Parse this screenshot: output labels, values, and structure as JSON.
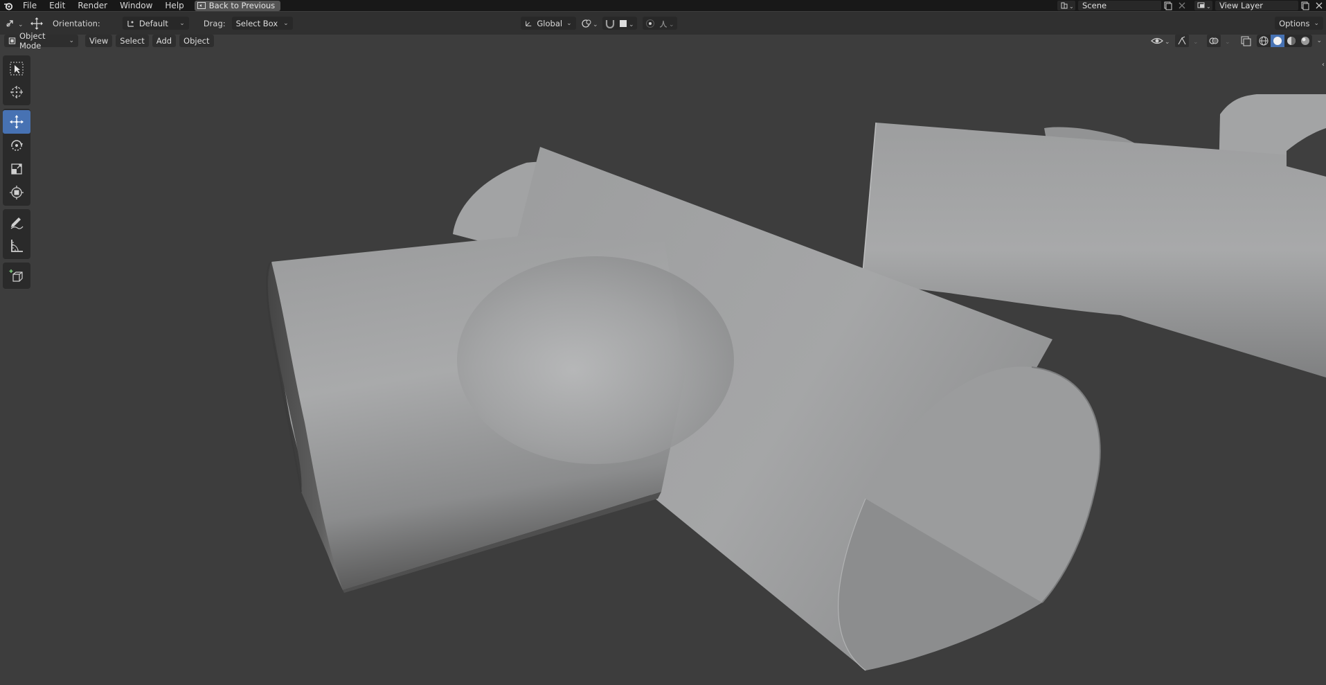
{
  "topbar": {
    "menu": [
      "File",
      "Edit",
      "Render",
      "Window",
      "Help"
    ],
    "back_button": "Back to Previous",
    "scene": "Scene",
    "view_layer": "View Layer"
  },
  "tool_settings": {
    "orientation_label": "Orientation:",
    "orientation_value": "Default",
    "drag_label": "Drag:",
    "drag_value": "Select Box",
    "transform_orientation": "Global",
    "options": "Options"
  },
  "viewport_header": {
    "mode": "Object Mode",
    "menus": [
      "View",
      "Select",
      "Add",
      "Object"
    ]
  },
  "toolbar": {
    "tools": [
      "select-box-icon",
      "cursor-icon",
      "move-icon",
      "rotate-icon",
      "scale-icon",
      "transform-icon",
      "annotate-icon",
      "measure-icon",
      "add-cube-icon"
    ],
    "active": "move-icon"
  },
  "colors": {
    "viewport_bg": "#3d3d3d",
    "accent": "#4772b3",
    "mesh": "#a3a4a5"
  }
}
